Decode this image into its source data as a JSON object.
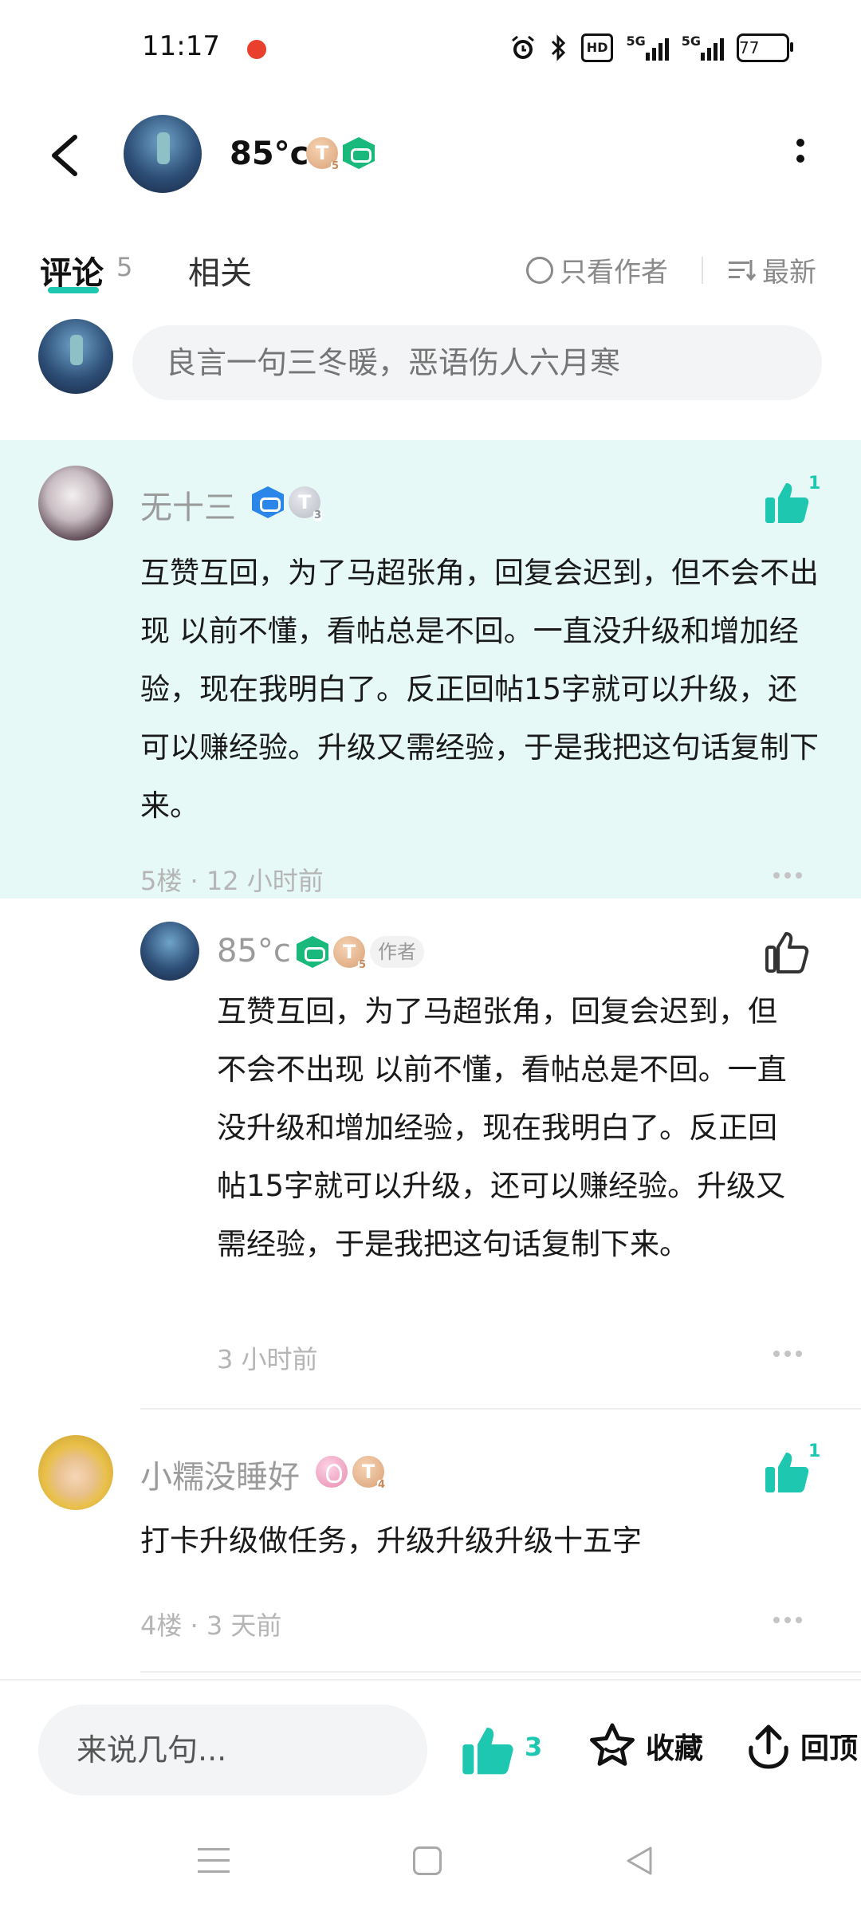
{
  "status_bar": {
    "time": "11:17",
    "signal_label_1": "5G",
    "signal_label_2": "5G",
    "hd_label": "HD",
    "battery": "77"
  },
  "header": {
    "title": "85°c",
    "badge_level": "T",
    "badge_level_sub": "5",
    "icons": [
      "back-arrow-icon",
      "game-badge-icon",
      "more-vertical-icon"
    ]
  },
  "tabs": {
    "comments_label": "评论",
    "comments_count": "5",
    "related_label": "相关",
    "only_author_label": "只看作者",
    "sort_label": "最新"
  },
  "compose": {
    "placeholder": "良言一句三冬暖，恶语伤人六月寒"
  },
  "comments": [
    {
      "user": "无十三",
      "badge_level": "T",
      "badge_level_sub": "3",
      "text": "互赞互回，为了马超张角，回复会迟到，但不会不出现 以前不懂，看帖总是不回。一直没升级和增加经验，现在我明白了。反正回帖15字就可以升级，还可以赚经验。升级又需经验，于是我把这句话复制下来。",
      "meta": "5楼 · 12 小时前",
      "likes": "1"
    },
    {
      "user": "85°c",
      "badge_level": "T",
      "badge_level_sub": "5",
      "author_tag": "作者",
      "text": "互赞互回，为了马超张角，回复会迟到，但不会不出现 以前不懂，看帖总是不回。一直没升级和增加经验，现在我明白了。反正回帖15字就可以升级，还可以赚经验。升级又需经验，于是我把这句话复制下来。",
      "meta": "3 小时前"
    },
    {
      "user": "小糯没睡好",
      "badge_level": "T",
      "badge_level_sub": "4",
      "text": "打卡升级做任务，升级升级升级十五字",
      "meta": "4楼 · 3 天前",
      "likes": "1"
    }
  ],
  "bottom_bar": {
    "input_placeholder": "来说几句...",
    "like_count": "3",
    "favorite_label": "收藏",
    "top_label": "回顶"
  },
  "colors": {
    "accent": "#1ec7b0",
    "highlight_bg": "#e6f9f6",
    "muted_text": "#9b9b9b"
  }
}
